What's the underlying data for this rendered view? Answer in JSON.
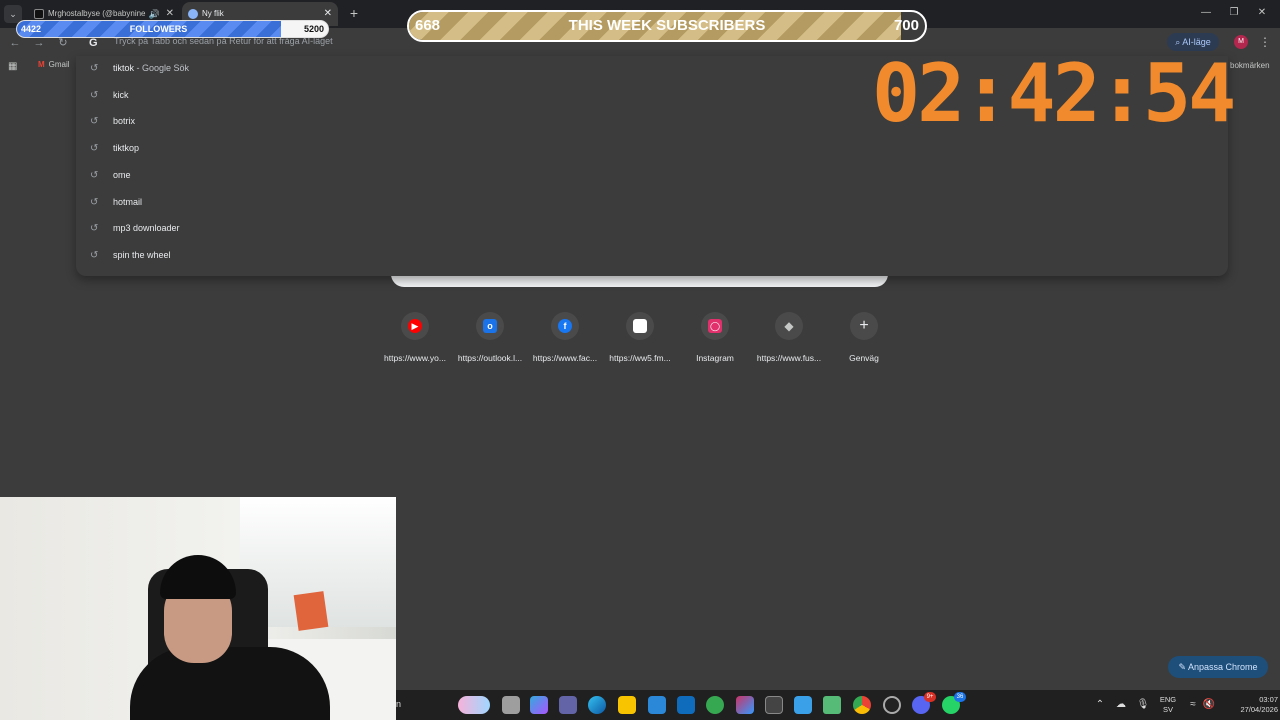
{
  "browser": {
    "tabs": [
      {
        "title": "Mrghostalbyse (@babynine",
        "audible": true
      },
      {
        "title": "Ny flik",
        "audible": false
      }
    ],
    "omnibox_placeholder": "Tryck på Tabb och sedan på Retur för att fråga AI-läget",
    "ai_mode_label": "AI-läge",
    "profile_initial": "M",
    "bookmarks": {
      "gmail": "Gmail",
      "all_bookmarks": "bokmärken"
    }
  },
  "suggestions": [
    {
      "text": "tiktok",
      "suffix": " - Google Sök"
    },
    {
      "text": "kick",
      "suffix": ""
    },
    {
      "text": "botrix",
      "suffix": ""
    },
    {
      "text": "tiktkop",
      "suffix": ""
    },
    {
      "text": "ome",
      "suffix": ""
    },
    {
      "text": "hotmail",
      "suffix": ""
    },
    {
      "text": "mp3 downloader",
      "suffix": ""
    },
    {
      "text": "spin the wheel",
      "suffix": ""
    }
  ],
  "shortcuts": [
    {
      "label": "https://www.yo...",
      "icon": "youtube-icon",
      "color": "#ff0000"
    },
    {
      "label": "https://outlook.l...",
      "icon": "outlook-icon",
      "color": "#1a73e8"
    },
    {
      "label": "https://www.fac...",
      "icon": "facebook-icon",
      "color": "#1877f2"
    },
    {
      "label": "https://ww5.fm...",
      "icon": "blank-page-icon",
      "color": "#ffffff"
    },
    {
      "label": "Instagram",
      "icon": "instagram-icon",
      "color": "#e1306c"
    },
    {
      "label": "https://www.fus...",
      "icon": "diamond-icon",
      "color": "#9aa0a6"
    },
    {
      "label": "Genväg",
      "icon": "plus-icon",
      "color": "#e8eaed"
    }
  ],
  "customize_label": "Anpassa Chrome",
  "overlay": {
    "followers": {
      "current": "4422",
      "label": "FOLLOWERS",
      "goal": "5200",
      "progress": 0.85
    },
    "subscribers": {
      "current": "668",
      "label": "THIS WEEK SUBSCRIBERS",
      "goal": "700",
      "progress": 0.954
    },
    "timer": "02:42:54"
  },
  "taskbar": {
    "edge_text": "n",
    "lang_top": "ENG",
    "lang_bottom": "SV",
    "time": "03:07",
    "date": "27/04/2026",
    "whatsapp_badge": "36",
    "discord_badge": "9+"
  },
  "colors": {
    "timer": "#f08a2c",
    "followers_fill": "#3b6fd8",
    "subscribers_fill": "#c8ad72",
    "page_bg": "#3c3c3c"
  }
}
